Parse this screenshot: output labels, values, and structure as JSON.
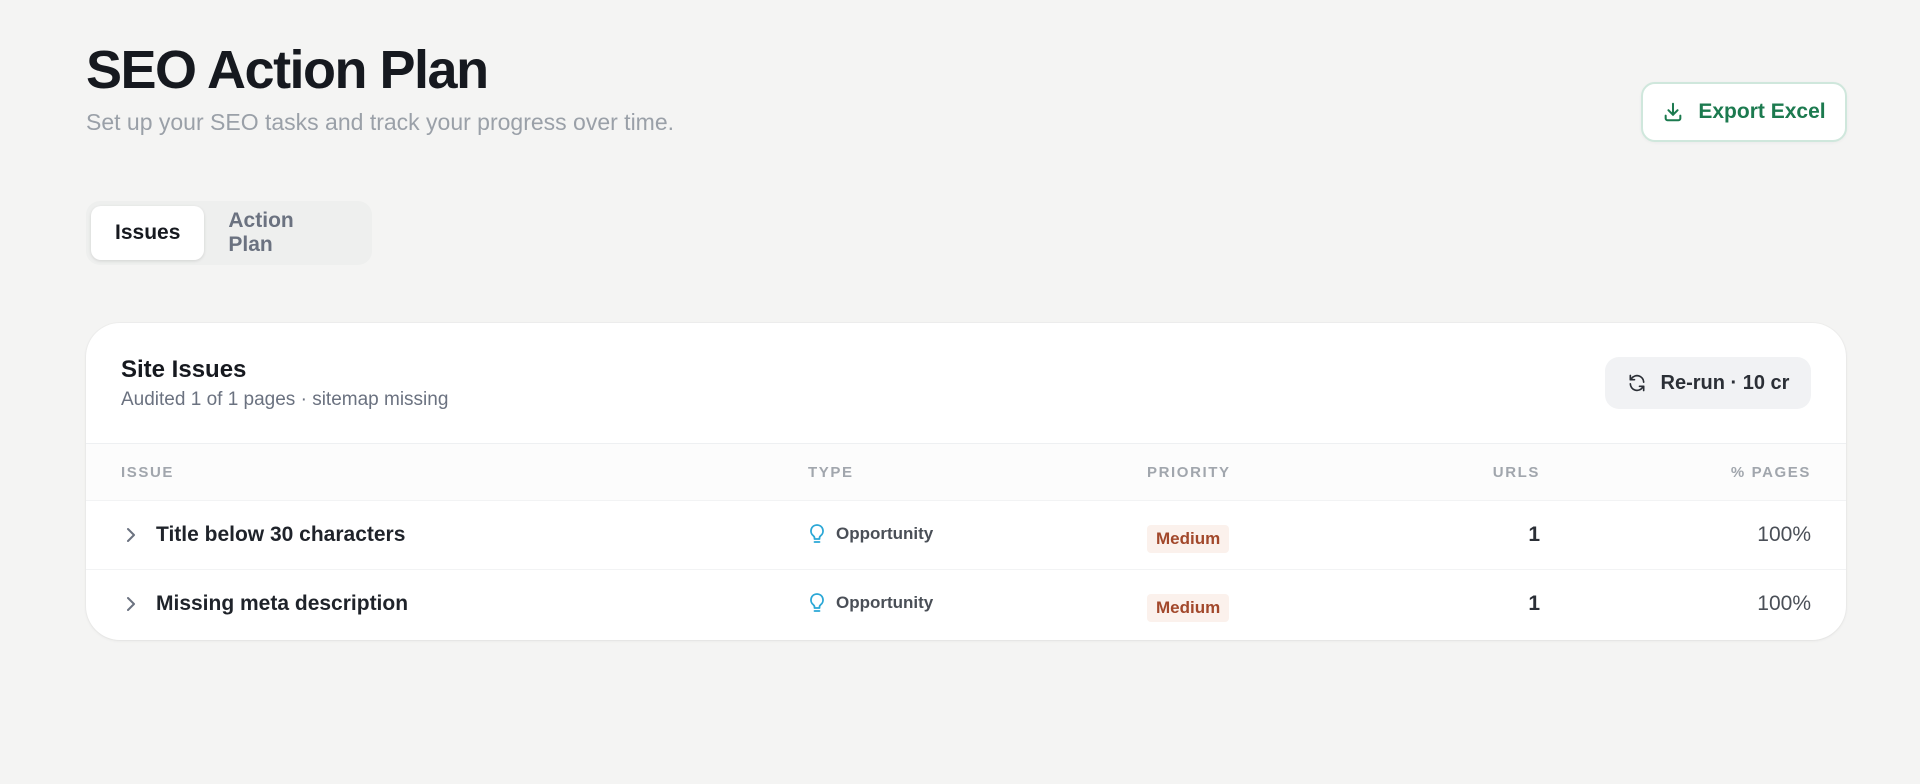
{
  "header": {
    "title": "SEO Action Plan",
    "subtitle": "Set up your SEO tasks and track your progress over time."
  },
  "toolbar": {
    "export_label": "Export Excel",
    "export_icon": "download-icon"
  },
  "tabs": [
    {
      "label": "Issues",
      "active": true
    },
    {
      "label": "Action Plan",
      "active": false
    }
  ],
  "card": {
    "title": "Site Issues",
    "subtitle": "Audited 1 of 1 pages · sitemap missing",
    "rerun_label": "Re-run · 10 cr",
    "rerun_icon": "refresh-icon"
  },
  "table": {
    "columns": [
      "Issue",
      "Type",
      "Priority",
      "URLs",
      "% Pages"
    ],
    "rows": [
      {
        "issue": "Title below 30 characters",
        "type": "Opportunity",
        "type_icon": "lightbulb-icon",
        "priority": "Medium",
        "urls": "1",
        "pct": "100%"
      },
      {
        "issue": "Missing meta description",
        "type": "Opportunity",
        "type_icon": "lightbulb-icon",
        "priority": "Medium",
        "urls": "1",
        "pct": "100%"
      }
    ]
  },
  "colors": {
    "accent_green": "#1c7a4f",
    "priority_medium_text": "#a2482b",
    "priority_medium_bg": "#fbf1ec",
    "opportunity_icon": "#2aa7d6"
  }
}
